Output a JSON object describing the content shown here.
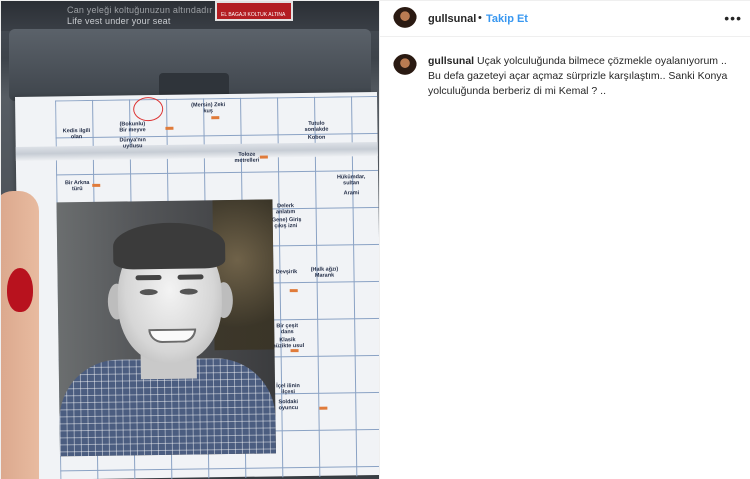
{
  "post": {
    "username": "gullsunal",
    "separator": "•",
    "follow_label": "Takip Et",
    "more_label": "•••",
    "caption_username": "gullsunal",
    "caption_text": "Uçak yolculuğunda bilmece çözmekle oyalanıyorum .. Bu defa gazeteyi açar açmaz sürprizle karşılaştım.. Sanki Konya yolculuğunda berberiz di mi Kemal ? .."
  },
  "photo": {
    "seat_text_line1": "Can yeleği koltuğunuzun altındadır",
    "seat_text_line2": "Life vest under your seat",
    "seat_label_text": "EL BAGAJI KOLTUK ALTINA",
    "clues": [
      "(Bokunlu) Bir meyve",
      "(Mersin) Zeki kuş",
      "Kedis ilgili olan",
      "Dünya'nın uydusu",
      "Tutulo sonlakde",
      "Kobon",
      "Toloze metrelleri",
      "Bir Arkna türü",
      "Hükümdar, sultan",
      "Arami",
      "Delerk anlatım",
      "(Gene) Giriş çıkış izni",
      "Devşirik",
      "(Halk ağzı) Marank",
      "Bir çeşit dans",
      "Klasik müzikte usul",
      "İçel ilinin ilçesi",
      "Soldaki oyuncu"
    ]
  }
}
